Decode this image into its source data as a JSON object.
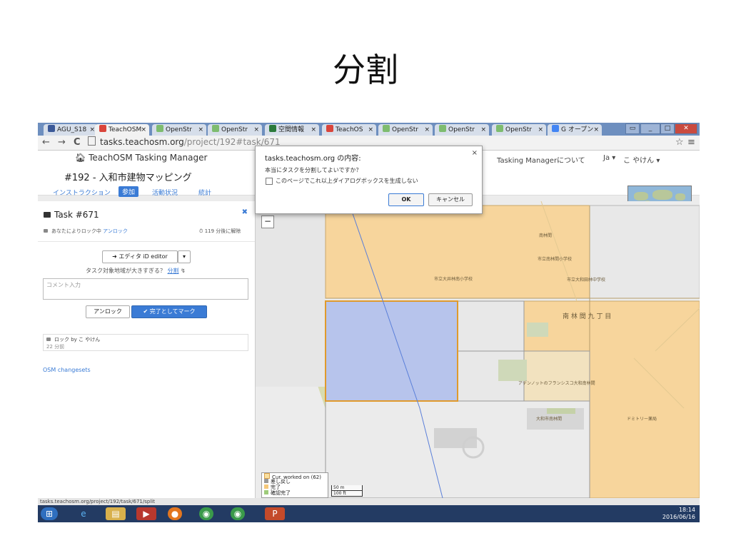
{
  "slide": {
    "title": "分割"
  },
  "browser": {
    "tabs": [
      {
        "label": "AGU_S18",
        "icon_color": "#3b5998"
      },
      {
        "label": "TeachOSM",
        "icon_color": "#d9453b"
      },
      {
        "label": "OpenStr",
        "icon_color": "#7ebc6f"
      },
      {
        "label": "OpenStr",
        "icon_color": "#7ebc6f"
      },
      {
        "label": "空間情報",
        "icon_color": "#2b7a3b"
      },
      {
        "label": "TeachOS",
        "icon_color": "#d9453b"
      },
      {
        "label": "OpenStr",
        "icon_color": "#7ebc6f"
      },
      {
        "label": "OpenStr",
        "icon_color": "#7ebc6f"
      },
      {
        "label": "OpenStr",
        "icon_color": "#7ebc6f"
      },
      {
        "label": "G オープン",
        "icon_color": "#4285f4"
      }
    ],
    "url_host": "tasks.teachosm.org",
    "url_path": "/project/192#task/671",
    "star": "☆",
    "menu": "≡",
    "back": "←",
    "forward": "→",
    "reload": "C",
    "status_url": "tasks.teachosm.org/project/192/task/671/split"
  },
  "header": {
    "brand": "TeachOSM Tasking Manager",
    "project_title": "#192 - 入和市建物マッピング",
    "tabs": [
      "インストラクション",
      "参加",
      "活動状況",
      "統計"
    ],
    "right_links": [
      "Tasking Managerについて",
      "Ja ▾",
      "こ やけん ▾"
    ]
  },
  "task_panel": {
    "title": "Task #671",
    "locked_status": "あなたによりロック中",
    "unlock_link": "アンロック",
    "time_left": "119 分後に解除",
    "editor_button": "エディタ iD editor",
    "split_question": "タスク対象地域が大きすぎる？",
    "split_link": "分割",
    "comment_placeholder": "コメント入力",
    "unlock_button": "アンロック",
    "done_button": "完了としてマーク",
    "history_line1": "ロック by こ やけん",
    "history_line2": "22 分前",
    "osm_changesets": "OSM changesets"
  },
  "dialog": {
    "title": "tasks.teachosm.org の内容:",
    "message": "本当にタスクを分割してよいですか？",
    "checkbox_label": "このページでこれ以上ダイアログボックスを生成しない",
    "ok": "OK",
    "cancel": "キャンセル",
    "close": "×"
  },
  "map": {
    "zoom_out": "−",
    "labels": [
      "市立大井林南小学校",
      "市立大和田林中学校",
      "市立南林間小学校",
      "南 林 間 九 丁 目",
      "大和市南林間",
      "ドミトリー薬局",
      "アデンノットのフランシスコ大和南林間",
      "南林間"
    ],
    "legend": [
      {
        "label": "Cur. worked on (62)",
        "color": "#f9e0a0"
      },
      {
        "label": "差し戻し",
        "color": "#999999"
      },
      {
        "label": "完了",
        "color": "#f5c87a"
      },
      {
        "label": "確認完了",
        "color": "#9ecb7a"
      }
    ],
    "scale": [
      "50 m",
      "100 ft"
    ]
  },
  "taskbar": {
    "time": "18:14",
    "date": "2016/06/16"
  }
}
